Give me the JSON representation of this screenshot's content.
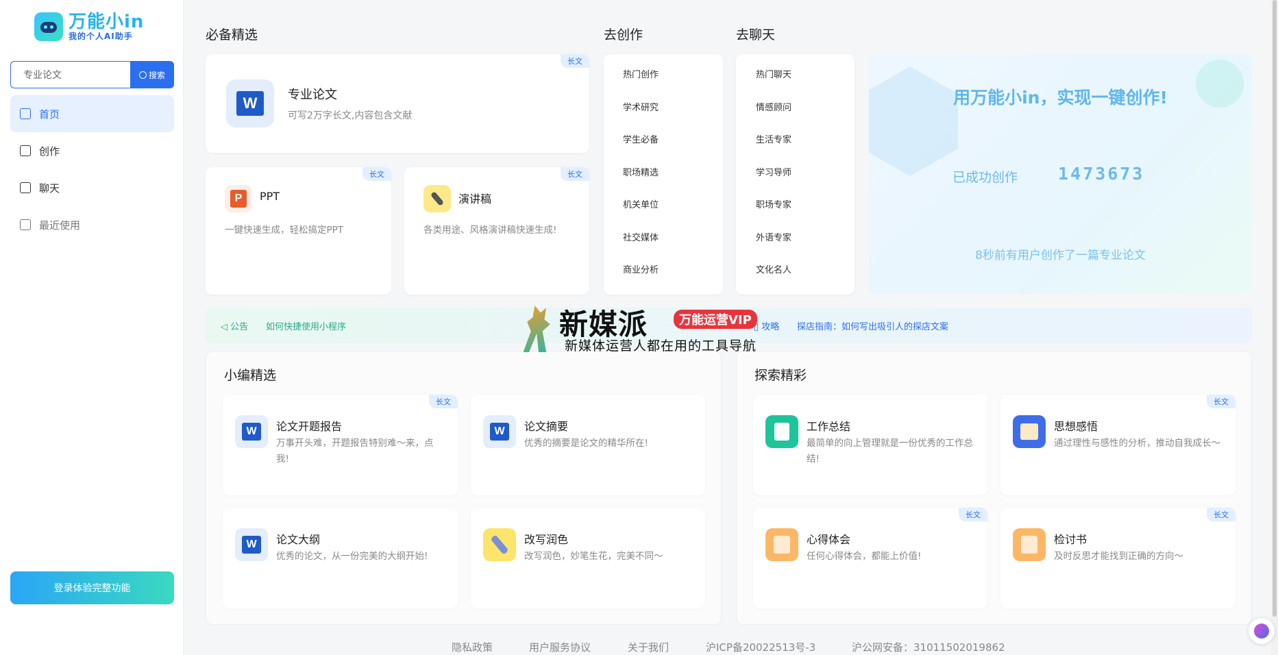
{
  "app": {
    "title": "万能小in",
    "subtitle": "我的个人AI助手"
  },
  "search": {
    "value": "专业论文",
    "button": "搜索"
  },
  "nav": [
    {
      "label": "首页"
    },
    {
      "label": "创作"
    },
    {
      "label": "聊天"
    },
    {
      "label": "最近使用"
    }
  ],
  "login_button": "登录体验完整功能",
  "sections": {
    "featured": "必备精选",
    "create": "去创作",
    "chat": "去聊天",
    "editor": "小编精选",
    "explore": "探索精彩"
  },
  "tag": "长文",
  "featured": {
    "main": {
      "title": "专业论文",
      "desc": "可写2万字长文,内容包含文献"
    },
    "ppt": {
      "title": "PPT",
      "desc": "一键快速生成，轻松搞定PPT"
    },
    "speech": {
      "title": "演讲稿",
      "desc": "各类用途、风格演讲稿快速生成!"
    }
  },
  "create_links": [
    "热门创作",
    "学术研究",
    "学生必备",
    "职场精选",
    "机关单位",
    "社交媒体",
    "商业分析"
  ],
  "chat_links": [
    "热门聊天",
    "情感顾问",
    "生活专家",
    "学习导师",
    "职场专家",
    "外语专家",
    "文化名人"
  ],
  "promo": {
    "title": "用万能小in，实现一键创作!",
    "label": "已成功创作",
    "count": "1473673",
    "footer": "8秒前有用户创作了一篇专业论文"
  },
  "notice": {
    "label": "公告",
    "text": "如何快捷使用小程序",
    "label2": "攻略",
    "text2": "探店指南：如何写出吸引人的探店文案"
  },
  "watermark": {
    "name": "新媒派",
    "vip": "万能运营VIP",
    "slogan": "新媒体运营人都在用的工具导航"
  },
  "editor_cards": [
    {
      "title": "论文开题报告",
      "desc": "万事开头难，开题报告特别难～来，点我!"
    },
    {
      "title": "论文摘要",
      "desc": "优秀的摘要是论文的精华所在!"
    },
    {
      "title": "论文大纲",
      "desc": "优秀的论文，从一份完美的大纲开始!"
    },
    {
      "title": "改写润色",
      "desc": "改写润色，妙笔生花，完美不同～"
    }
  ],
  "explore_cards": [
    {
      "title": "工作总结",
      "desc": "最简单的向上管理就是一份优秀的工作总结!"
    },
    {
      "title": "思想感悟",
      "desc": "通过理性与感性的分析，推动自我成长～"
    },
    {
      "title": "心得体会",
      "desc": "任何心得体会，都能上价值!"
    },
    {
      "title": "检讨书",
      "desc": "及时反思才能找到正确的方向～"
    }
  ],
  "footer": [
    "隐私政策",
    "用户服务协议",
    "关于我们",
    "沪ICP备20022513号-3",
    "沪公网安备：31011502019862"
  ]
}
